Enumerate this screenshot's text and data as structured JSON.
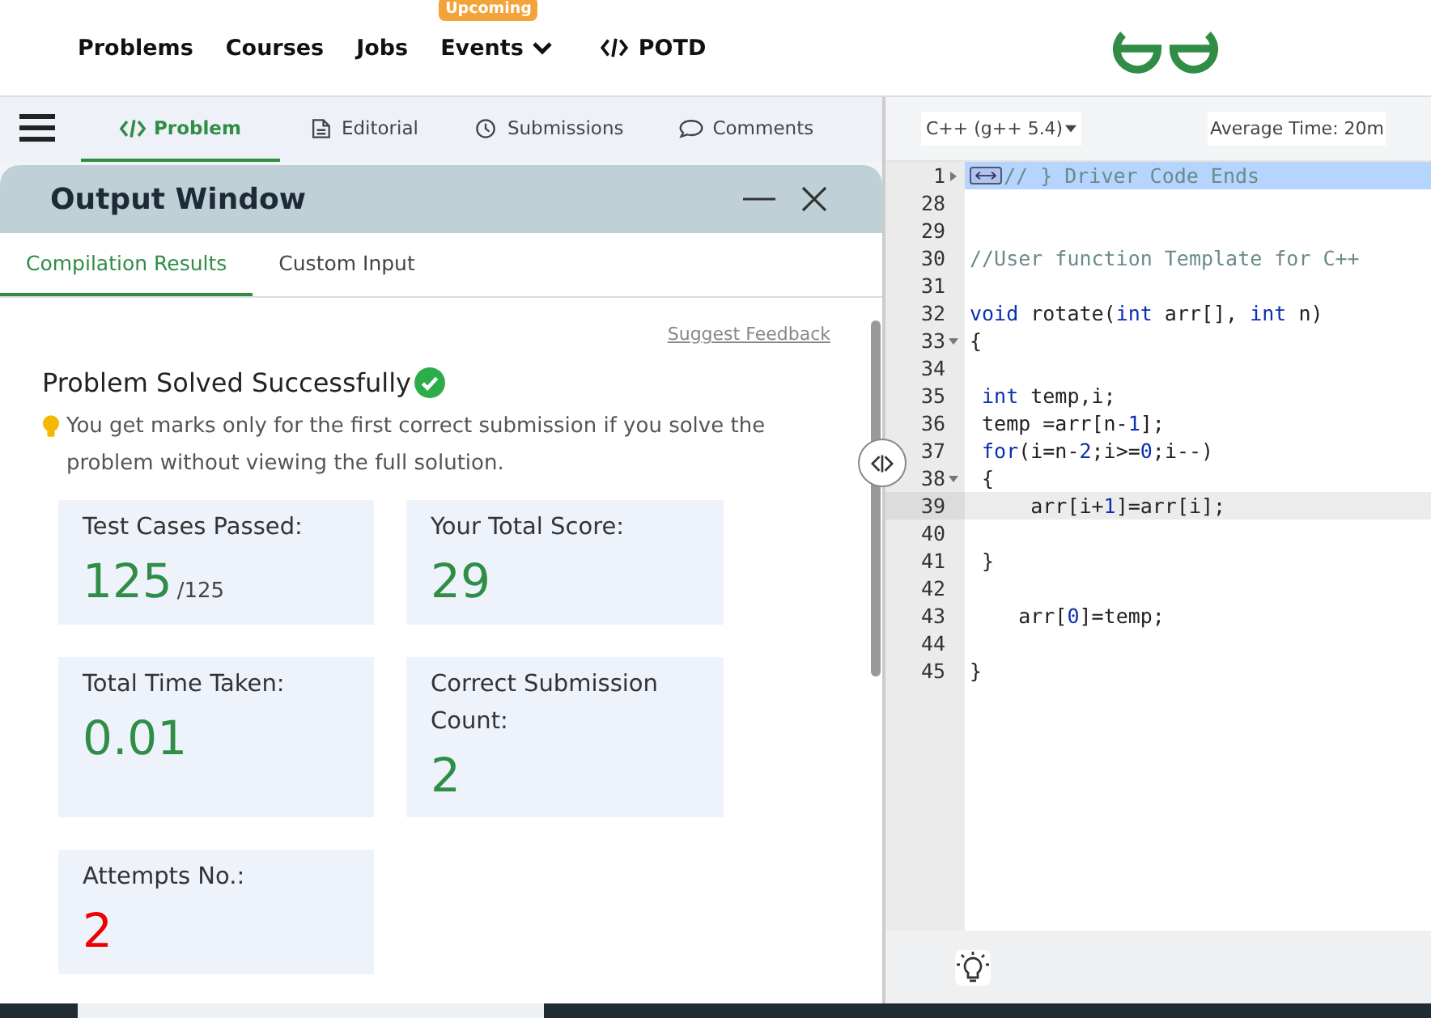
{
  "nav": {
    "items": [
      {
        "label": "Problems",
        "kind": "link"
      },
      {
        "label": "Courses",
        "kind": "link"
      },
      {
        "label": "Jobs",
        "kind": "link"
      },
      {
        "label": "Events",
        "kind": "dropdown",
        "badge": "Upcoming"
      },
      {
        "label": "POTD",
        "kind": "code"
      }
    ]
  },
  "tabs": [
    {
      "label": "Problem",
      "selected": true
    },
    {
      "label": "Editorial",
      "selected": false
    },
    {
      "label": "Submissions",
      "selected": false
    },
    {
      "label": "Comments",
      "selected": false
    }
  ],
  "output_window": {
    "title": "Output Window",
    "tabs": [
      {
        "label": "Compilation Results",
        "selected": true
      },
      {
        "label": "Custom Input",
        "selected": false
      }
    ],
    "feedback_link": "Suggest Feedback",
    "heading": "Problem Solved Successfully",
    "note": "You get marks only for the first correct submission if you solve the problem without viewing the full solution.",
    "stats": [
      {
        "label": "Test Cases Passed:",
        "value": "125",
        "suffix": "/125",
        "kind": "good"
      },
      {
        "label": "Your Total Score:",
        "value": "29",
        "kind": "good"
      },
      {
        "label": "Total Time Taken:",
        "value": "0.01",
        "kind": "good"
      },
      {
        "label": "Correct Submission Count:",
        "value": "2",
        "kind": "good"
      },
      {
        "label": "Attempts No.:",
        "value": "2",
        "kind": "bad"
      }
    ]
  },
  "editor": {
    "language": "C++ (g++ 5.4)",
    "average_time": "Average Time: 20m",
    "lines": [
      {
        "number": "1",
        "expanded": false,
        "selected": true,
        "current": false,
        "tokens": [
          {
            "t": "// } Driver Code Ends",
            "kind": "comment"
          }
        ]
      },
      {
        "number": "28",
        "selected": false,
        "current": false
      },
      {
        "number": "29",
        "selected": false,
        "current": false
      },
      {
        "number": "30",
        "selected": false,
        "current": false,
        "tokens": [
          {
            "t": "//User function Template for C++",
            "kind": "comment"
          }
        ]
      },
      {
        "number": "31",
        "selected": false,
        "current": false
      },
      {
        "number": "32",
        "selected": false,
        "current": false,
        "tokens": [
          {
            "t": "void",
            "kind": "keyword"
          },
          {
            "t": " rotate(",
            "kind": "plain"
          },
          {
            "t": "int",
            "kind": "keyword"
          },
          {
            "t": " arr[], ",
            "kind": "plain"
          },
          {
            "t": "int",
            "kind": "keyword"
          },
          {
            "t": " n)",
            "kind": "plain"
          }
        ]
      },
      {
        "number": "33",
        "expanded": true,
        "selected": false,
        "current": false,
        "tokens": [
          {
            "t": "{",
            "kind": "plain"
          }
        ]
      },
      {
        "number": "34",
        "selected": false,
        "current": false
      },
      {
        "number": "35",
        "selected": false,
        "current": false,
        "tokens": [
          {
            "t": " int",
            "kind": "keyword"
          },
          {
            "t": " temp,i;",
            "kind": "plain"
          }
        ]
      },
      {
        "number": "36",
        "selected": false,
        "current": false,
        "tokens": [
          {
            "t": " temp =arr[n-",
            "kind": "plain"
          },
          {
            "t": "1",
            "kind": "number"
          },
          {
            "t": "];",
            "kind": "plain"
          }
        ]
      },
      {
        "number": "37",
        "selected": false,
        "current": false,
        "tokens": [
          {
            "t": " for",
            "kind": "keyword"
          },
          {
            "t": "(i=n-",
            "kind": "plain"
          },
          {
            "t": "2",
            "kind": "number"
          },
          {
            "t": ";i>=",
            "kind": "plain"
          },
          {
            "t": "0",
            "kind": "number"
          },
          {
            "t": ";i--)",
            "kind": "plain"
          }
        ]
      },
      {
        "number": "38",
        "expanded": true,
        "selected": false,
        "current": false,
        "tokens": [
          {
            "t": " {",
            "kind": "plain"
          }
        ]
      },
      {
        "number": "39",
        "selected": false,
        "current": true,
        "tokens": [
          {
            "t": "     arr[i+",
            "kind": "plain"
          },
          {
            "t": "1",
            "kind": "number"
          },
          {
            "t": "]=arr[i];",
            "kind": "plain"
          }
        ]
      },
      {
        "number": "40",
        "selected": false,
        "current": false
      },
      {
        "number": "41",
        "selected": false,
        "current": false,
        "tokens": [
          {
            "t": " }",
            "kind": "plain"
          }
        ]
      },
      {
        "number": "42",
        "selected": false,
        "current": false
      },
      {
        "number": "43",
        "selected": false,
        "current": false,
        "tokens": [
          {
            "t": "    arr[",
            "kind": "plain"
          },
          {
            "t": "0",
            "kind": "number"
          },
          {
            "t": "]=temp;",
            "kind": "plain"
          }
        ]
      },
      {
        "number": "44",
        "selected": false,
        "current": false
      },
      {
        "number": "45",
        "selected": false,
        "current": false,
        "tokens": [
          {
            "t": "}",
            "kind": "plain"
          }
        ]
      }
    ]
  }
}
